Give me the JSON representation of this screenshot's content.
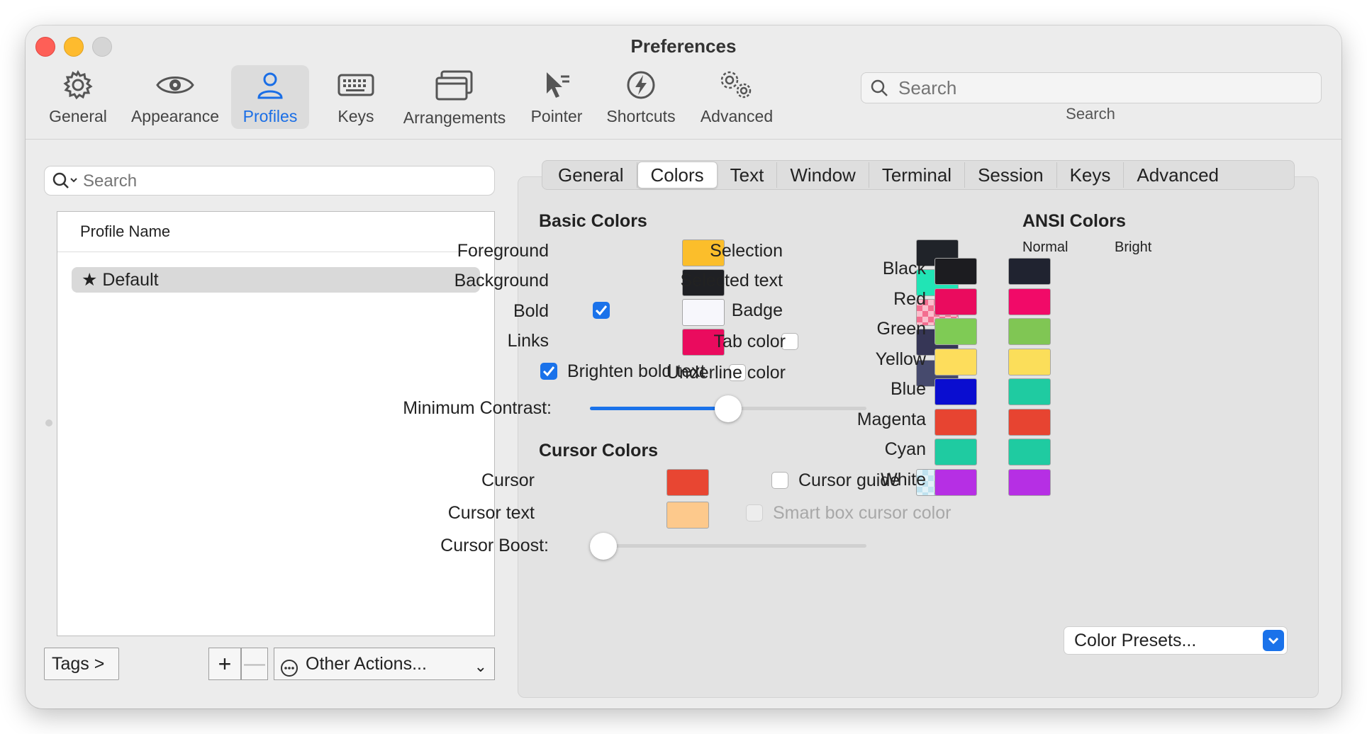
{
  "window": {
    "title": "Preferences"
  },
  "toolbar": {
    "items": [
      {
        "label": "General",
        "icon": "gear-icon"
      },
      {
        "label": "Appearance",
        "icon": "eye-icon"
      },
      {
        "label": "Profiles",
        "icon": "person-icon",
        "active": true
      },
      {
        "label": "Keys",
        "icon": "keyboard-icon"
      },
      {
        "label": "Arrangements",
        "icon": "windows-icon"
      },
      {
        "label": "Pointer",
        "icon": "pointer-icon"
      },
      {
        "label": "Shortcuts",
        "icon": "bolt-icon"
      },
      {
        "label": "Advanced",
        "icon": "gears-icon"
      }
    ],
    "search_placeholder": "Search",
    "search_label": "Search"
  },
  "sidebar": {
    "search_placeholder": "Search",
    "column_header": "Profile Name",
    "profiles": [
      {
        "name": "Default",
        "is_default": true
      }
    ],
    "tags_button": "Tags >",
    "add_button": "+",
    "remove_button": "—",
    "other_actions": "Other Actions..."
  },
  "tabs": [
    "General",
    "Colors",
    "Text",
    "Window",
    "Terminal",
    "Session",
    "Keys",
    "Advanced"
  ],
  "active_tab": "Colors",
  "basic_colors": {
    "title": "Basic Colors",
    "foreground": {
      "label": "Foreground",
      "color": "#fbbe2b"
    },
    "background": {
      "label": "Background",
      "color": "#1f2024"
    },
    "bold": {
      "label": "Bold",
      "color": "#f7f7fc",
      "checked": true
    },
    "links": {
      "label": "Links",
      "color": "#ea0b5e"
    },
    "selection": {
      "label": "Selection",
      "color": "#202329"
    },
    "selected_text": {
      "label": "Selected text",
      "color": "#21e4b5"
    },
    "badge": {
      "label": "Badge",
      "color": "#f36e8f"
    },
    "tab_color": {
      "label": "Tab color",
      "color": "#363656",
      "checked": false
    },
    "underline_color": {
      "label": "Underline color",
      "color": "#464a6d",
      "checked": false
    },
    "brighten_bold": {
      "label": "Brighten bold text",
      "checked": true
    },
    "min_contrast": {
      "label": "Minimum Contrast:",
      "value": 0.5
    }
  },
  "cursor_colors": {
    "title": "Cursor Colors",
    "cursor": {
      "label": "Cursor",
      "color": "#e84632"
    },
    "cursor_text": {
      "label": "Cursor text",
      "color": "#fdc98c"
    },
    "cursor_guide": {
      "label": "Cursor guide",
      "color": "#bfe2ef",
      "checked": false
    },
    "smart_box": {
      "label": "Smart box cursor color",
      "checked": false,
      "disabled": true
    },
    "cursor_boost": {
      "label": "Cursor Boost:",
      "value": 0.0
    }
  },
  "ansi_colors": {
    "title": "ANSI Colors",
    "normal_header": "Normal",
    "bright_header": "Bright",
    "rows": [
      {
        "name": "Black",
        "normal": "#1c1c20",
        "bright": "#202330"
      },
      {
        "name": "Red",
        "normal": "#ea0b5e",
        "bright": "#f10a68"
      },
      {
        "name": "Green",
        "normal": "#7fcb55",
        "bright": "#80c654"
      },
      {
        "name": "Yellow",
        "normal": "#fddd5c",
        "bright": "#fbde5a"
      },
      {
        "name": "Blue",
        "normal": "#0a0dd0",
        "bright": "#1fcba1"
      },
      {
        "name": "Magenta",
        "normal": "#e74431",
        "bright": "#e74431"
      },
      {
        "name": "Cyan",
        "normal": "#1fcba1",
        "bright": "#1fcba1"
      },
      {
        "name": "White",
        "normal": "#b62fe4",
        "bright": "#b62fe4"
      }
    ]
  },
  "color_presets": "Color Presets..."
}
